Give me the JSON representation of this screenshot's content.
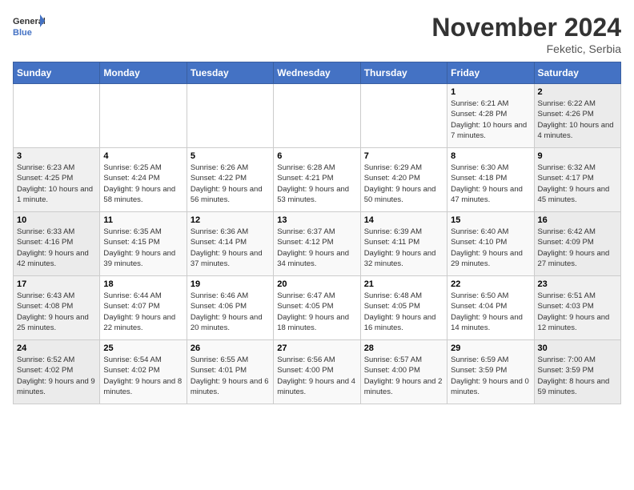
{
  "logo": {
    "text_general": "General",
    "text_blue": "Blue"
  },
  "title": "November 2024",
  "subtitle": "Feketic, Serbia",
  "days_of_week": [
    "Sunday",
    "Monday",
    "Tuesday",
    "Wednesday",
    "Thursday",
    "Friday",
    "Saturday"
  ],
  "weeks": [
    [
      {
        "day": "",
        "info": ""
      },
      {
        "day": "",
        "info": ""
      },
      {
        "day": "",
        "info": ""
      },
      {
        "day": "",
        "info": ""
      },
      {
        "day": "",
        "info": ""
      },
      {
        "day": "1",
        "info": "Sunrise: 6:21 AM\nSunset: 4:28 PM\nDaylight: 10 hours and 7 minutes."
      },
      {
        "day": "2",
        "info": "Sunrise: 6:22 AM\nSunset: 4:26 PM\nDaylight: 10 hours and 4 minutes."
      }
    ],
    [
      {
        "day": "3",
        "info": "Sunrise: 6:23 AM\nSunset: 4:25 PM\nDaylight: 10 hours and 1 minute."
      },
      {
        "day": "4",
        "info": "Sunrise: 6:25 AM\nSunset: 4:24 PM\nDaylight: 9 hours and 58 minutes."
      },
      {
        "day": "5",
        "info": "Sunrise: 6:26 AM\nSunset: 4:22 PM\nDaylight: 9 hours and 56 minutes."
      },
      {
        "day": "6",
        "info": "Sunrise: 6:28 AM\nSunset: 4:21 PM\nDaylight: 9 hours and 53 minutes."
      },
      {
        "day": "7",
        "info": "Sunrise: 6:29 AM\nSunset: 4:20 PM\nDaylight: 9 hours and 50 minutes."
      },
      {
        "day": "8",
        "info": "Sunrise: 6:30 AM\nSunset: 4:18 PM\nDaylight: 9 hours and 47 minutes."
      },
      {
        "day": "9",
        "info": "Sunrise: 6:32 AM\nSunset: 4:17 PM\nDaylight: 9 hours and 45 minutes."
      }
    ],
    [
      {
        "day": "10",
        "info": "Sunrise: 6:33 AM\nSunset: 4:16 PM\nDaylight: 9 hours and 42 minutes."
      },
      {
        "day": "11",
        "info": "Sunrise: 6:35 AM\nSunset: 4:15 PM\nDaylight: 9 hours and 39 minutes."
      },
      {
        "day": "12",
        "info": "Sunrise: 6:36 AM\nSunset: 4:14 PM\nDaylight: 9 hours and 37 minutes."
      },
      {
        "day": "13",
        "info": "Sunrise: 6:37 AM\nSunset: 4:12 PM\nDaylight: 9 hours and 34 minutes."
      },
      {
        "day": "14",
        "info": "Sunrise: 6:39 AM\nSunset: 4:11 PM\nDaylight: 9 hours and 32 minutes."
      },
      {
        "day": "15",
        "info": "Sunrise: 6:40 AM\nSunset: 4:10 PM\nDaylight: 9 hours and 29 minutes."
      },
      {
        "day": "16",
        "info": "Sunrise: 6:42 AM\nSunset: 4:09 PM\nDaylight: 9 hours and 27 minutes."
      }
    ],
    [
      {
        "day": "17",
        "info": "Sunrise: 6:43 AM\nSunset: 4:08 PM\nDaylight: 9 hours and 25 minutes."
      },
      {
        "day": "18",
        "info": "Sunrise: 6:44 AM\nSunset: 4:07 PM\nDaylight: 9 hours and 22 minutes."
      },
      {
        "day": "19",
        "info": "Sunrise: 6:46 AM\nSunset: 4:06 PM\nDaylight: 9 hours and 20 minutes."
      },
      {
        "day": "20",
        "info": "Sunrise: 6:47 AM\nSunset: 4:05 PM\nDaylight: 9 hours and 18 minutes."
      },
      {
        "day": "21",
        "info": "Sunrise: 6:48 AM\nSunset: 4:05 PM\nDaylight: 9 hours and 16 minutes."
      },
      {
        "day": "22",
        "info": "Sunrise: 6:50 AM\nSunset: 4:04 PM\nDaylight: 9 hours and 14 minutes."
      },
      {
        "day": "23",
        "info": "Sunrise: 6:51 AM\nSunset: 4:03 PM\nDaylight: 9 hours and 12 minutes."
      }
    ],
    [
      {
        "day": "24",
        "info": "Sunrise: 6:52 AM\nSunset: 4:02 PM\nDaylight: 9 hours and 9 minutes."
      },
      {
        "day": "25",
        "info": "Sunrise: 6:54 AM\nSunset: 4:02 PM\nDaylight: 9 hours and 8 minutes."
      },
      {
        "day": "26",
        "info": "Sunrise: 6:55 AM\nSunset: 4:01 PM\nDaylight: 9 hours and 6 minutes."
      },
      {
        "day": "27",
        "info": "Sunrise: 6:56 AM\nSunset: 4:00 PM\nDaylight: 9 hours and 4 minutes."
      },
      {
        "day": "28",
        "info": "Sunrise: 6:57 AM\nSunset: 4:00 PM\nDaylight: 9 hours and 2 minutes."
      },
      {
        "day": "29",
        "info": "Sunrise: 6:59 AM\nSunset: 3:59 PM\nDaylight: 9 hours and 0 minutes."
      },
      {
        "day": "30",
        "info": "Sunrise: 7:00 AM\nSunset: 3:59 PM\nDaylight: 8 hours and 59 minutes."
      }
    ]
  ]
}
